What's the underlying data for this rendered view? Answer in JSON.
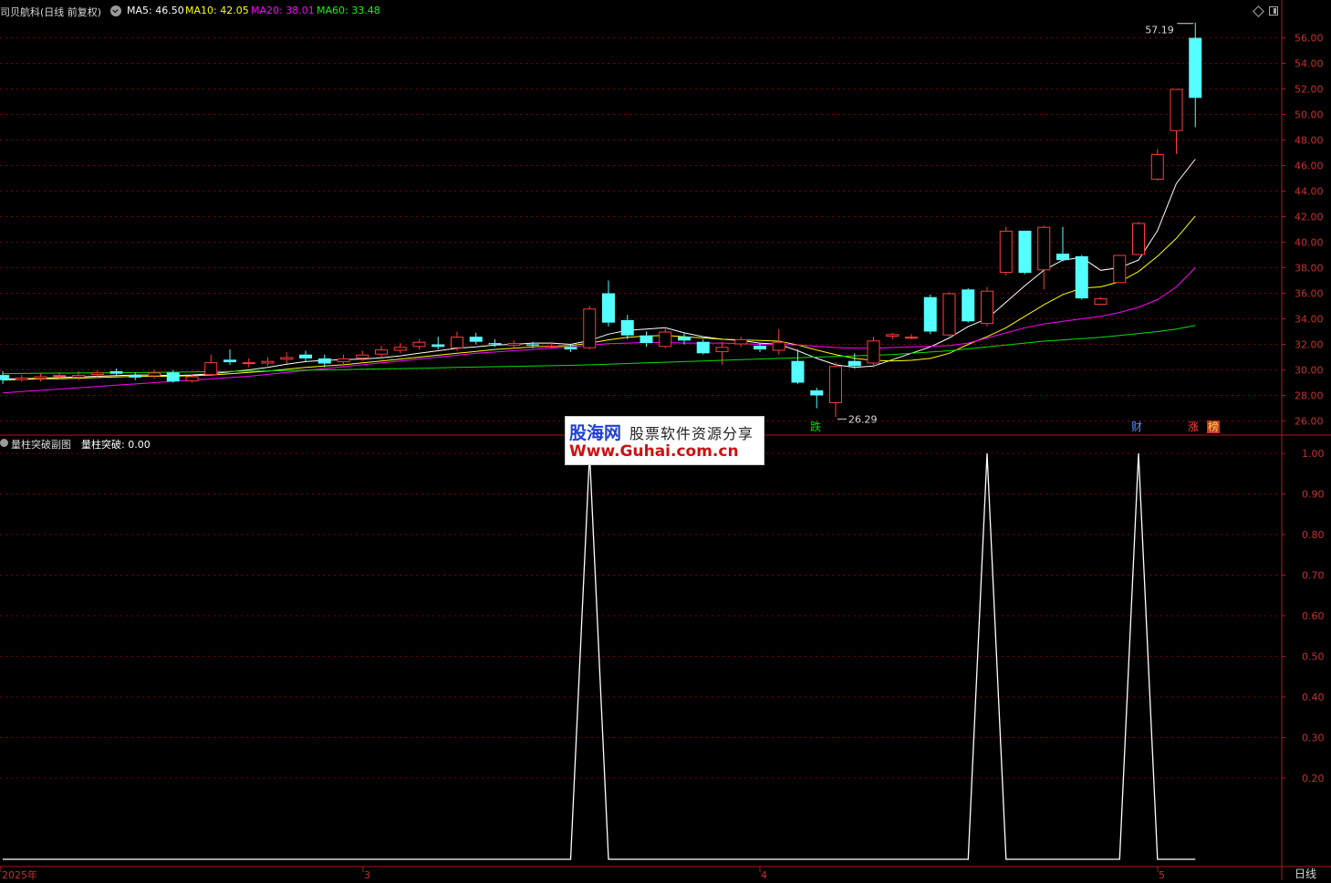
{
  "header": {
    "stock_title": "司贝航科(日线 前复权)",
    "ma5_label": "MA5: 46.50",
    "ma10_label": "MA10: 42.05",
    "ma20_label": "MA20: 38.01",
    "ma60_label": "MA60: 33.48"
  },
  "indicator_header": {
    "name": "量柱突破副图",
    "value_label": "量柱突破: 0.00"
  },
  "markers": {
    "fall": "跌",
    "cai": "财",
    "zhang": "涨",
    "bang": "榜"
  },
  "annotations": {
    "high": "57.19",
    "low": "26.29"
  },
  "x_axis": {
    "labels": [
      "2025年",
      "3",
      "4",
      "5"
    ]
  },
  "period_button": "日线",
  "watermark": {
    "brand": "股海网",
    "tagline": "股票软件资源分享",
    "url": "Www.Guhai.com.cn"
  },
  "colors": {
    "background": "#000000",
    "up_candle": "#ff3c3c",
    "down_candle": "#54ffff",
    "ma5": "#ffffff",
    "ma10": "#ffff00",
    "ma20": "#ff00ff",
    "ma60": "#00e000",
    "grid": "#7a0000",
    "axis_text": "#c83030"
  },
  "chart_data": [
    {
      "type": "candlestick",
      "price_axis": {
        "ticks": [
          "56.00",
          "54.00",
          "52.00",
          "50.00",
          "48.00",
          "46.00",
          "44.00",
          "42.00",
          "40.00",
          "38.00",
          "36.00",
          "34.00",
          "32.00",
          "30.00",
          "28.00",
          "26.00"
        ],
        "ylim": [
          25.0,
          58.5
        ]
      },
      "candles": [
        [
          29.6,
          29.2,
          29.9,
          28.9
        ],
        [
          29.2,
          29.4,
          29.6,
          29.1
        ],
        [
          29.3,
          29.5,
          29.7,
          29.1
        ],
        [
          29.5,
          29.6,
          29.8,
          29.3
        ],
        [
          29.4,
          29.6,
          29.9,
          29.2
        ],
        [
          29.6,
          29.8,
          30.0,
          29.4
        ],
        [
          29.9,
          29.7,
          30.1,
          29.5
        ],
        [
          29.6,
          29.4,
          29.8,
          29.2
        ],
        [
          29.5,
          29.8,
          30.0,
          29.3
        ],
        [
          29.8,
          29.1,
          30.0,
          29.0
        ],
        [
          29.1,
          29.5,
          29.7,
          29.0
        ],
        [
          29.6,
          30.6,
          31.2,
          29.5
        ],
        [
          30.8,
          30.6,
          31.6,
          30.4
        ],
        [
          30.5,
          30.6,
          30.9,
          30.2
        ],
        [
          30.5,
          30.7,
          31.0,
          30.3
        ],
        [
          30.8,
          31.0,
          31.4,
          30.5
        ],
        [
          31.2,
          30.9,
          31.5,
          30.6
        ],
        [
          30.9,
          30.5,
          31.2,
          30.2
        ],
        [
          30.6,
          30.9,
          31.2,
          30.4
        ],
        [
          30.9,
          31.2,
          31.5,
          30.7
        ],
        [
          31.2,
          31.6,
          31.9,
          31.0
        ],
        [
          31.5,
          31.8,
          32.1,
          31.3
        ],
        [
          31.8,
          32.2,
          32.4,
          31.6
        ],
        [
          32.0,
          31.8,
          32.6,
          31.6
        ],
        [
          31.7,
          32.6,
          33.0,
          31.5
        ],
        [
          32.6,
          32.2,
          32.9,
          32.0
        ],
        [
          32.1,
          32.0,
          32.4,
          31.8
        ],
        [
          31.9,
          32.1,
          32.3,
          31.7
        ],
        [
          32.0,
          31.9,
          32.2,
          31.7
        ],
        [
          31.9,
          31.9,
          32.2,
          31.7
        ],
        [
          31.8,
          31.6,
          32.0,
          31.4
        ],
        [
          31.7,
          34.8,
          35.0,
          31.6
        ],
        [
          36.0,
          33.7,
          37.0,
          33.4
        ],
        [
          33.9,
          32.7,
          34.3,
          32.4
        ],
        [
          32.7,
          32.1,
          33.0,
          31.8
        ],
        [
          31.8,
          33.0,
          33.3,
          31.7
        ],
        [
          32.6,
          32.3,
          32.9,
          32.0
        ],
        [
          32.2,
          31.3,
          32.4,
          31.2
        ],
        [
          31.4,
          31.8,
          32.2,
          30.4
        ],
        [
          32.0,
          32.4,
          32.6,
          31.8
        ],
        [
          31.9,
          31.6,
          32.1,
          31.4
        ],
        [
          31.5,
          32.2,
          33.2,
          31.2
        ],
        [
          30.7,
          29.0,
          31.6,
          28.9
        ],
        [
          28.4,
          28.0,
          28.6,
          27.0
        ],
        [
          27.4,
          30.3,
          30.6,
          26.3
        ],
        [
          30.7,
          30.3,
          31.3,
          30.1
        ],
        [
          30.5,
          32.3,
          32.6,
          30.2
        ],
        [
          32.6,
          32.8,
          32.9,
          32.4
        ],
        [
          32.6,
          32.6,
          32.8,
          32.4
        ],
        [
          35.7,
          33.0,
          35.9,
          32.8
        ],
        [
          32.7,
          36.0,
          36.1,
          32.6
        ],
        [
          36.3,
          33.8,
          36.4,
          33.7
        ],
        [
          33.6,
          36.2,
          36.5,
          33.4
        ],
        [
          37.6,
          40.9,
          41.2,
          37.4
        ],
        [
          40.9,
          37.6,
          40.9,
          37.5
        ],
        [
          37.8,
          41.2,
          41.3,
          36.3
        ],
        [
          39.1,
          38.6,
          41.2,
          38.5
        ],
        [
          38.9,
          35.6,
          39.0,
          35.5
        ],
        [
          35.1,
          35.6,
          35.7,
          35.1
        ],
        [
          36.8,
          39.0,
          39.0,
          36.8
        ],
        [
          39.0,
          41.5,
          41.6,
          39.0
        ],
        [
          44.9,
          46.9,
          47.3,
          44.8
        ],
        [
          48.7,
          52.0,
          52.0,
          46.9
        ],
        [
          56.0,
          51.3,
          57.2,
          49.0
        ]
      ],
      "moving_averages": [
        {
          "name": "MA5",
          "values": [
            29.3,
            29.3,
            29.35,
            29.4,
            29.45,
            29.5,
            29.55,
            29.6,
            29.6,
            29.55,
            29.6,
            29.7,
            29.85,
            30.0,
            30.2,
            30.45,
            30.65,
            30.75,
            30.8,
            30.85,
            30.95,
            31.1,
            31.3,
            31.5,
            31.7,
            31.8,
            31.95,
            32.0,
            32.1,
            32.1,
            32.0,
            32.3,
            32.8,
            33.1,
            33.2,
            33.3,
            32.9,
            32.6,
            32.4,
            32.3,
            32.1,
            32.0,
            31.5,
            30.9,
            30.4,
            30.2,
            30.3,
            30.8,
            31.3,
            31.8,
            32.5,
            33.4,
            34.0,
            35.3,
            36.6,
            37.8,
            38.6,
            38.8,
            37.8,
            38.0,
            38.6,
            40.9,
            44.6,
            46.5
          ]
        },
        {
          "name": "MA10",
          "values": [
            29.2,
            29.25,
            29.3,
            29.3,
            29.35,
            29.4,
            29.45,
            29.5,
            29.5,
            29.5,
            29.55,
            29.6,
            29.7,
            29.8,
            29.9,
            30.05,
            30.2,
            30.3,
            30.4,
            30.55,
            30.7,
            30.85,
            31.0,
            31.15,
            31.3,
            31.45,
            31.6,
            31.7,
            31.8,
            31.85,
            31.9,
            32.1,
            32.35,
            32.55,
            32.65,
            32.7,
            32.6,
            32.5,
            32.4,
            32.35,
            32.3,
            32.25,
            31.95,
            31.55,
            31.2,
            30.9,
            30.75,
            30.7,
            30.75,
            30.9,
            31.3,
            32.0,
            32.6,
            33.3,
            34.2,
            35.1,
            35.9,
            36.4,
            36.5,
            36.9,
            37.7,
            38.9,
            40.3,
            42.05
          ]
        },
        {
          "name": "MA20",
          "values": [
            28.2,
            28.3,
            28.4,
            28.5,
            28.6,
            28.7,
            28.8,
            28.9,
            29.0,
            29.1,
            29.2,
            29.3,
            29.4,
            29.5,
            29.65,
            29.8,
            29.95,
            30.1,
            30.25,
            30.4,
            30.55,
            30.7,
            30.85,
            31.0,
            31.15,
            31.3,
            31.4,
            31.5,
            31.6,
            31.7,
            31.8,
            31.95,
            32.05,
            32.1,
            32.15,
            32.15,
            32.1,
            32.1,
            32.1,
            32.05,
            32.0,
            32.0,
            31.95,
            31.85,
            31.75,
            31.7,
            31.7,
            31.75,
            31.8,
            31.85,
            31.9,
            32.1,
            32.5,
            32.9,
            33.3,
            33.6,
            33.8,
            34.0,
            34.2,
            34.5,
            34.9,
            35.5,
            36.5,
            38.01
          ]
        },
        {
          "name": "MA60",
          "values": [
            29.7,
            29.72,
            29.74,
            29.75,
            29.76,
            29.77,
            29.78,
            29.79,
            29.8,
            29.82,
            29.84,
            29.86,
            29.88,
            29.9,
            29.92,
            29.95,
            29.98,
            30.0,
            30.02,
            30.05,
            30.08,
            30.1,
            30.13,
            30.16,
            30.19,
            30.22,
            30.25,
            30.28,
            30.3,
            30.33,
            30.36,
            30.4,
            30.45,
            30.5,
            30.55,
            30.6,
            30.65,
            30.7,
            30.75,
            30.8,
            30.85,
            30.9,
            30.95,
            31.0,
            31.05,
            31.1,
            31.15,
            31.2,
            31.3,
            31.4,
            31.5,
            31.65,
            31.8,
            31.95,
            32.1,
            32.25,
            32.35,
            32.45,
            32.55,
            32.7,
            32.85,
            33.0,
            33.2,
            33.48
          ]
        }
      ]
    },
    {
      "type": "line",
      "title": "量柱突破",
      "y_axis": {
        "ticks": [
          "1.00",
          "0.90",
          "0.80",
          "0.70",
          "0.60",
          "0.50",
          "0.40",
          "0.30",
          "0.20"
        ],
        "ylim": [
          -0.005,
          1.005
        ]
      },
      "values": [
        0,
        0,
        0,
        0,
        0,
        0,
        0,
        0,
        0,
        0,
        0,
        0,
        0,
        0,
        0,
        0,
        0,
        0,
        0,
        0,
        0,
        0,
        0,
        0,
        0,
        0,
        0,
        0,
        0,
        0,
        0,
        1,
        0,
        0,
        0,
        0,
        0,
        0,
        0,
        0,
        0,
        0,
        0,
        0,
        0,
        0,
        0,
        0,
        0,
        0,
        0,
        0,
        1,
        0,
        0,
        0,
        0,
        0,
        0,
        0,
        1,
        0,
        0,
        0
      ]
    }
  ]
}
